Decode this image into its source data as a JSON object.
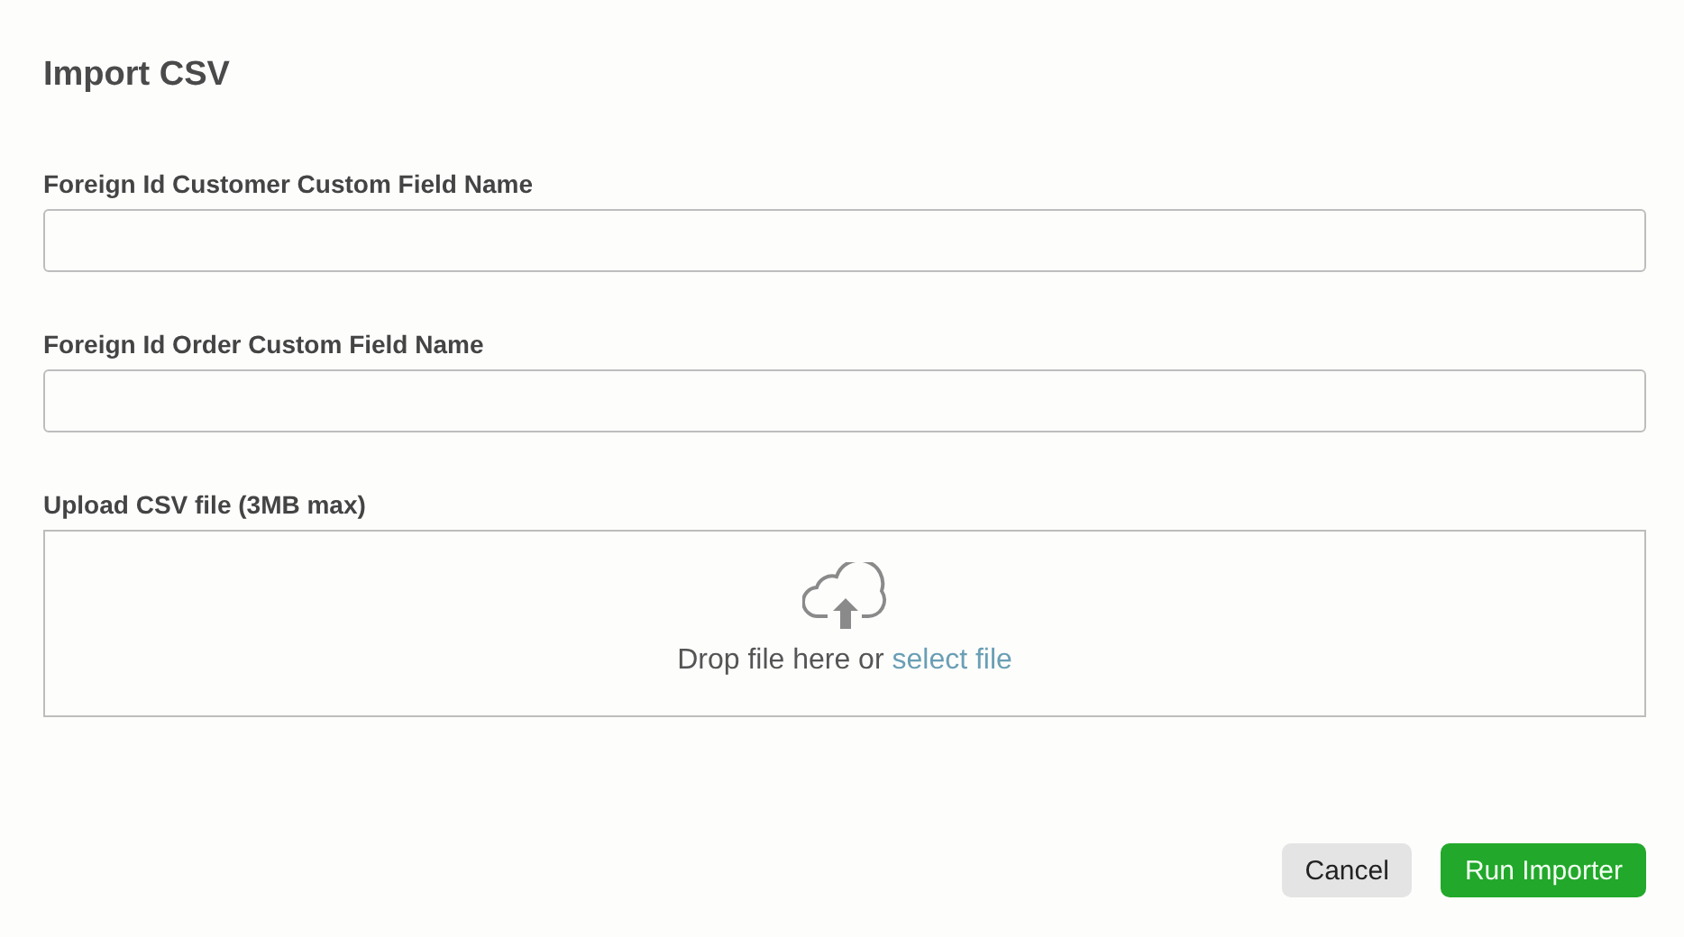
{
  "dialog": {
    "title": "Import CSV"
  },
  "fields": [
    {
      "label": "Foreign Id Customer Custom Field Name"
    },
    {
      "label": "Foreign Id Order Custom Field Name"
    }
  ],
  "upload": {
    "label": "Upload CSV file (3MB max)",
    "hint": "Drop file here or",
    "link": "select file"
  },
  "buttons": [
    {
      "label": "Cancel",
      "kind": "secondary"
    },
    {
      "label": "Run Importer",
      "kind": "primary"
    }
  ]
}
